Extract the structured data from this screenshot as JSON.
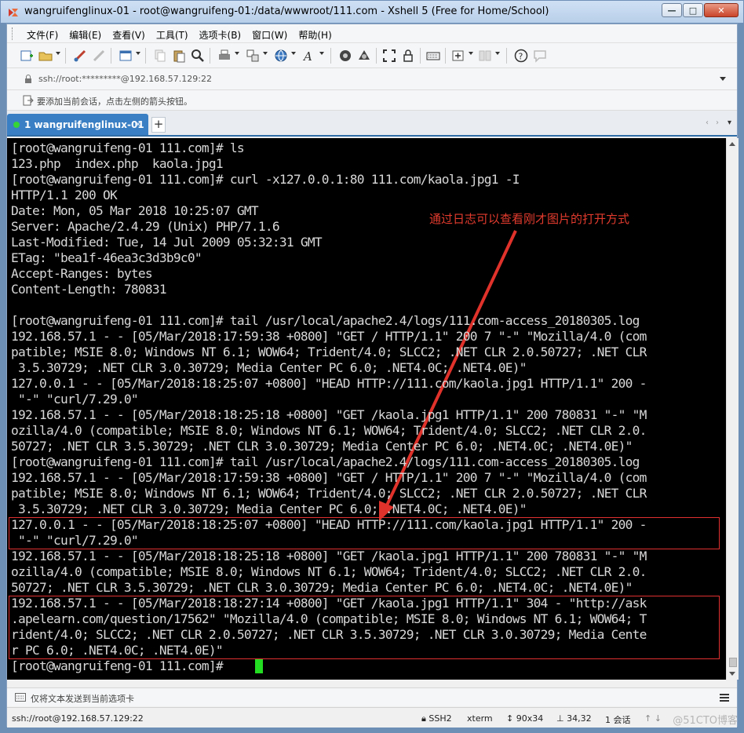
{
  "window": {
    "title": "wangruifenglinux-01 - root@wangruifeng-01:/data/wwwroot/111.com - Xshell 5 (Free for Home/School)",
    "minimize": "—",
    "maximize": "□",
    "close": "✕"
  },
  "menu": [
    "文件(F)",
    "编辑(E)",
    "查看(V)",
    "工具(T)",
    "选项卡(B)",
    "窗口(W)",
    "帮助(H)"
  ],
  "address": {
    "text": "ssh://root:*********@192.168.57.129:22"
  },
  "hint": {
    "text": "要添加当前会话，点击左侧的箭头按钮。"
  },
  "tabs": [
    {
      "label": "1 wangruifenglinux-01",
      "close": "×",
      "active": true
    }
  ],
  "tab_add": "+",
  "tab_nav": {
    "prev": "‹",
    "next": "›",
    "menu": "▾"
  },
  "terminal": {
    "lines": [
      "[root@wangruifeng-01 111.com]# ls",
      "123.php  index.php  kaola.jpg1",
      "[root@wangruifeng-01 111.com]# curl -x127.0.0.1:80 111.com/kaola.jpg1 -I",
      "HTTP/1.1 200 OK",
      "Date: Mon, 05 Mar 2018 10:25:07 GMT",
      "Server: Apache/2.4.29 (Unix) PHP/7.1.6",
      "Last-Modified: Tue, 14 Jul 2009 05:32:31 GMT",
      "ETag: \"bea1f-46ea3c3d3b9c0\"",
      "Accept-Ranges: bytes",
      "Content-Length: 780831",
      "",
      "[root@wangruifeng-01 111.com]# tail /usr/local/apache2.4/logs/111.com-access_20180305.log",
      "192.168.57.1 - - [05/Mar/2018:17:59:38 +0800] \"GET / HTTP/1.1\" 200 7 \"-\" \"Mozilla/4.0 (com",
      "patible; MSIE 8.0; Windows NT 6.1; WOW64; Trident/4.0; SLCC2; .NET CLR 2.0.50727; .NET CLR",
      " 3.5.30729; .NET CLR 3.0.30729; Media Center PC 6.0; .NET4.0C; .NET4.0E)\"",
      "127.0.0.1 - - [05/Mar/2018:18:25:07 +0800] \"HEAD HTTP://111.com/kaola.jpg1 HTTP/1.1\" 200 -",
      " \"-\" \"curl/7.29.0\"",
      "192.168.57.1 - - [05/Mar/2018:18:25:18 +0800] \"GET /kaola.jpg1 HTTP/1.1\" 200 780831 \"-\" \"M",
      "ozilla/4.0 (compatible; MSIE 8.0; Windows NT 6.1; WOW64; Trident/4.0; SLCC2; .NET CLR 2.0.",
      "50727; .NET CLR 3.5.30729; .NET CLR 3.0.30729; Media Center PC 6.0; .NET4.0C; .NET4.0E)\"",
      "[root@wangruifeng-01 111.com]# tail /usr/local/apache2.4/logs/111.com-access_20180305.log",
      "192.168.57.1 - - [05/Mar/2018:17:59:38 +0800] \"GET / HTTP/1.1\" 200 7 \"-\" \"Mozilla/4.0 (com",
      "patible; MSIE 8.0; Windows NT 6.1; WOW64; Trident/4.0; SLCC2; .NET CLR 2.0.50727; .NET CLR",
      " 3.5.30729; .NET CLR 3.0.30729; Media Center PC 6.0; .NET4.0C; .NET4.0E)\"",
      "127.0.0.1 - - [05/Mar/2018:18:25:07 +0800] \"HEAD HTTP://111.com/kaola.jpg1 HTTP/1.1\" 200 -",
      " \"-\" \"curl/7.29.0\"",
      "192.168.57.1 - - [05/Mar/2018:18:25:18 +0800] \"GET /kaola.jpg1 HTTP/1.1\" 200 780831 \"-\" \"M",
      "ozilla/4.0 (compatible; MSIE 8.0; Windows NT 6.1; WOW64; Trident/4.0; SLCC2; .NET CLR 2.0.",
      "50727; .NET CLR 3.5.30729; .NET CLR 3.0.30729; Media Center PC 6.0; .NET4.0C; .NET4.0E)\"",
      "192.168.57.1 - - [05/Mar/2018:18:27:14 +0800] \"GET /kaola.jpg1 HTTP/1.1\" 304 - \"http://ask",
      ".apelearn.com/question/17562\" \"Mozilla/4.0 (compatible; MSIE 8.0; Windows NT 6.1; WOW64; T",
      "rident/4.0; SLCC2; .NET CLR 2.0.50727; .NET CLR 3.5.30729; .NET CLR 3.0.30729; Media Cente",
      "r PC 6.0; .NET4.0C; .NET4.0E)\"",
      "[root@wangruifeng-01 111.com]# "
    ],
    "annotation": "通过日志可以查看刚才图片的打开方式",
    "colors": {
      "background": "#000000",
      "text": "#d8d8d8",
      "cursor": "#22dd22",
      "annotation": "#e23b2e",
      "highlight": "#e03030"
    }
  },
  "sendbar": {
    "text": "仅将文本发送到当前选项卡"
  },
  "status": {
    "connection": "ssh://root@192.168.57.129:22",
    "protocol": "SSH2",
    "terminal": "xterm",
    "size": "90x34",
    "cursor_pos": "34,32",
    "sessions": "1 会话"
  },
  "watermark": "@51CTO博客"
}
